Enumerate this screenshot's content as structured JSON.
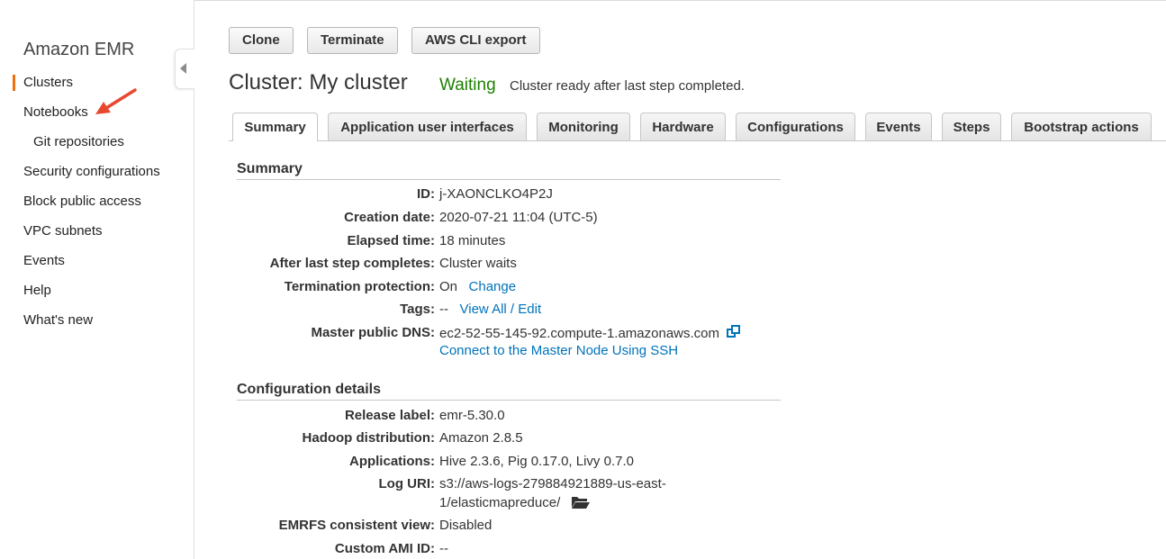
{
  "sidebar": {
    "brand": "Amazon EMR",
    "items": [
      {
        "label": "Clusters"
      },
      {
        "label": "Notebooks"
      },
      {
        "label": "Git repositories"
      },
      {
        "label": "Security configurations"
      },
      {
        "label": "Block public access"
      },
      {
        "label": "VPC subnets"
      },
      {
        "label": "Events"
      },
      {
        "label": "Help"
      },
      {
        "label": "What's new"
      }
    ]
  },
  "toolbar": {
    "clone_label": "Clone",
    "terminate_label": "Terminate",
    "cli_export_label": "AWS CLI export"
  },
  "cluster": {
    "title": "Cluster: My cluster",
    "status": "Waiting",
    "status_description": "Cluster ready after last step completed."
  },
  "tabs": [
    {
      "label": "Summary"
    },
    {
      "label": "Application user interfaces"
    },
    {
      "label": "Monitoring"
    },
    {
      "label": "Hardware"
    },
    {
      "label": "Configurations"
    },
    {
      "label": "Events"
    },
    {
      "label": "Steps"
    },
    {
      "label": "Bootstrap actions"
    }
  ],
  "summary": {
    "heading": "Summary",
    "id_label": "ID:",
    "id_value": "j-XAONCLKO4P2J",
    "creation_label": "Creation date:",
    "creation_value": "2020-07-21 11:04 (UTC-5)",
    "elapsed_label": "Elapsed time:",
    "elapsed_value": "18 minutes",
    "after_label": "After last step completes:",
    "after_value": "Cluster waits",
    "termination_label": "Termination protection:",
    "termination_value": "On",
    "termination_link": "Change",
    "tags_label": "Tags:",
    "tags_value": "--",
    "tags_link": "View All / Edit",
    "dns_label": "Master public DNS:",
    "dns_value": "ec2-52-55-145-92.compute-1.amazonaws.com",
    "ssh_link": "Connect to the Master Node Using SSH"
  },
  "config": {
    "heading": "Configuration details",
    "release_label": "Release label:",
    "release_value": "emr-5.30.0",
    "hadoop_label": "Hadoop distribution:",
    "hadoop_value": "Amazon 2.8.5",
    "apps_label": "Applications:",
    "apps_value": "Hive 2.3.6, Pig 0.17.0, Livy 0.7.0",
    "log_label": "Log URI:",
    "log_value_line1": "s3://aws-logs-279884921889-us-east-",
    "log_value_line2": "1/elasticmapreduce/",
    "emrfs_label": "EMRFS consistent view:",
    "emrfs_value": "Disabled",
    "ami_label": "Custom AMI ID:",
    "ami_value": "--"
  },
  "colors": {
    "status_green": "#1d8102",
    "link_blue": "#0073bb",
    "active_nav_orange": "#ec7211",
    "annotation_arrow": "#e8482f"
  }
}
